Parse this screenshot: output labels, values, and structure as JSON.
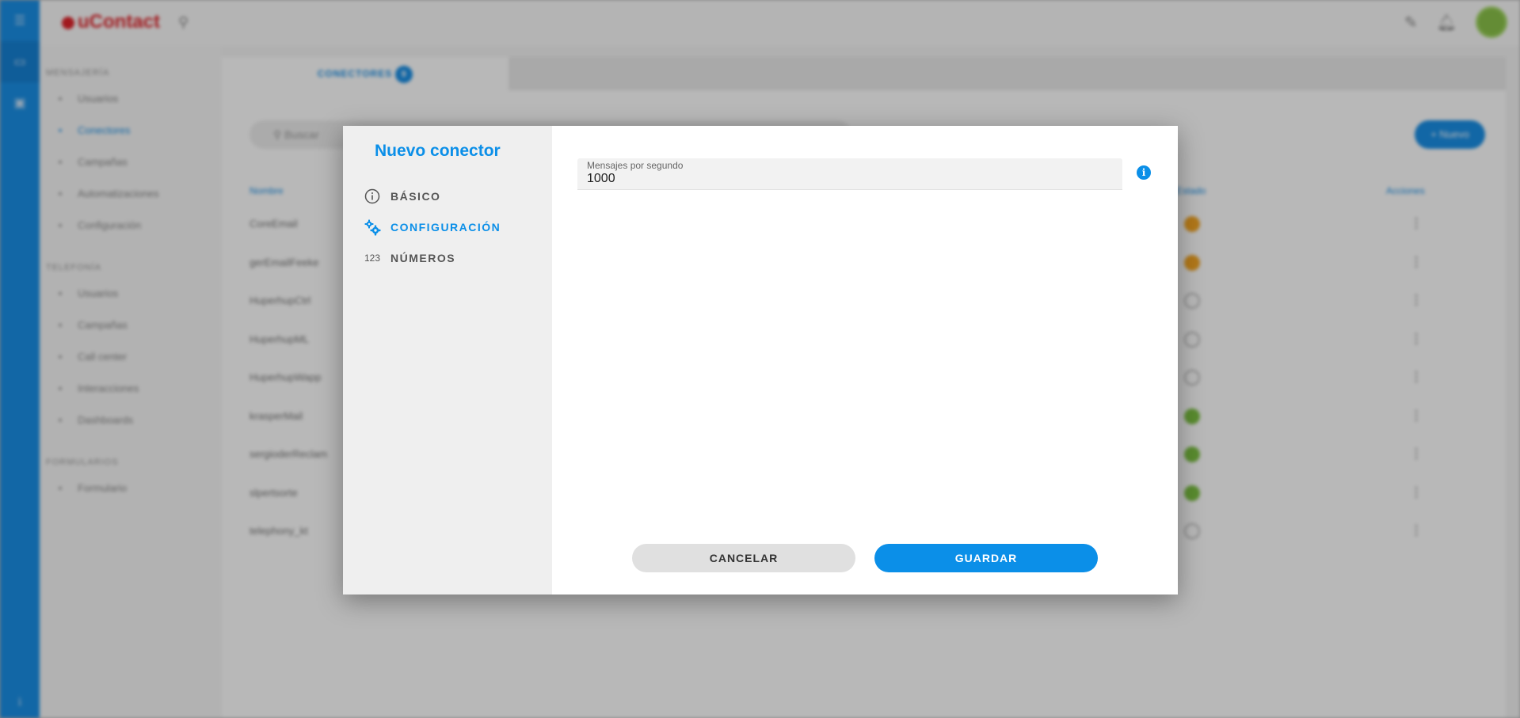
{
  "app": {
    "logo": "uContact",
    "colors": {
      "primary": "#0b8fe8",
      "rail": "#1a8fe6",
      "logo": "#e0242b"
    },
    "icons": [
      "menu-icon",
      "monitor-icon",
      "inbox-icon",
      "search-icon",
      "edit-icon",
      "bell-icon",
      "avatar"
    ]
  },
  "background": {
    "tab_label": "CONECTORES",
    "search_placeholder": "Buscar",
    "new_button": "Nuevo",
    "columns": {
      "name": "Nombre",
      "status": "Estado",
      "actions": "Acciones"
    },
    "sidebar": [
      {
        "section": "MENSAJERÍA"
      },
      {
        "label": "Usuarios",
        "icon": "user-icon"
      },
      {
        "label": "Conectores",
        "icon": "plug-icon",
        "active": true
      },
      {
        "label": "Campañas",
        "icon": "campaign-icon"
      },
      {
        "label": "Automatizaciones",
        "icon": "automation-icon"
      },
      {
        "label": "Configuración",
        "icon": "settings-icon"
      },
      {
        "section": "TELEFONÍA"
      },
      {
        "label": "Usuarios",
        "icon": "user-icon"
      },
      {
        "label": "Campañas",
        "icon": "campaign-icon"
      },
      {
        "label": "Call center",
        "icon": "call-icon"
      },
      {
        "label": "Interacciones",
        "icon": "interaction-icon"
      },
      {
        "label": "Dashboards",
        "icon": "dashboard-icon"
      },
      {
        "section": "FORMULARIOS"
      },
      {
        "label": "Formulario",
        "icon": "form-icon"
      }
    ],
    "rows": [
      {
        "name": "CoreEmail",
        "status": "warning",
        "status_color": "#f5a623"
      },
      {
        "name": "gerEmailFeeke",
        "status": "pending",
        "status_color": "#f5a623"
      },
      {
        "name": "HuperhupCtrl",
        "status": "inactive",
        "status_color": "#bbbbbb"
      },
      {
        "name": "HuperhupML",
        "status": "inactive",
        "status_color": "#bbbbbb"
      },
      {
        "name": "HuperhupWapp",
        "status": "inactive",
        "status_color": "#bbbbbb"
      },
      {
        "name": "krasperMail",
        "status": "active",
        "status_color": "#7cc142"
      },
      {
        "name": "sergioderReclam",
        "status": "active",
        "status_color": "#7cc142"
      },
      {
        "name": "slpertsorte",
        "status": "active",
        "status_color": "#7cc142"
      },
      {
        "name": "telephony_kt",
        "status": "inactive",
        "status_color": "#bbbbbb"
      }
    ]
  },
  "modal": {
    "title": "Nuevo conector",
    "nav": [
      {
        "label": "BÁSICO",
        "icon": "info-circle-icon",
        "active": false
      },
      {
        "label": "CONFIGURACIÓN",
        "icon": "gears-icon",
        "active": true
      },
      {
        "label": "NÚMEROS",
        "icon": "numbers-123-icon",
        "glyph": "123",
        "active": false
      }
    ],
    "field": {
      "label": "Mensajes por segundo",
      "value": "1000"
    },
    "buttons": {
      "cancel": "CANCELAR",
      "save": "GUARDAR"
    }
  }
}
